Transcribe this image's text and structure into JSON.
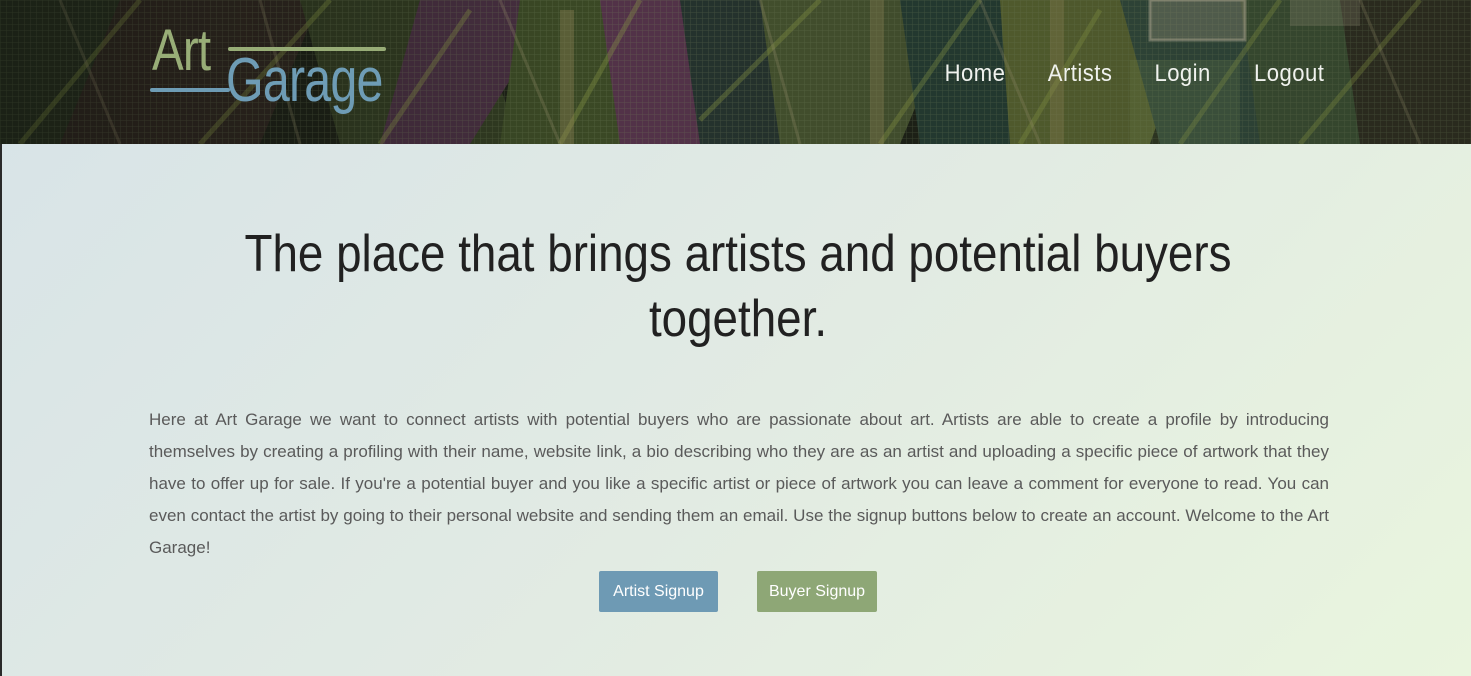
{
  "header": {
    "logo": {
      "word1": "Art",
      "word2": "Garage"
    },
    "nav": [
      {
        "label": "Home"
      },
      {
        "label": "Artists"
      },
      {
        "label": "Login"
      },
      {
        "label": "Logout"
      }
    ]
  },
  "main": {
    "headline": "The place that brings artists and potential buyers together.",
    "intro": "Here at Art Garage we want to connect artists with potential buyers who are passionate about art. Artists are able to create a profile by introducing themselves by creating a profiling with their name, website link, a bio describing who they are as an artist and uploading a specific piece of artwork that they have to offer up for sale. If you're a potential buyer and you like a specific artist or piece of artwork you can leave a comment for everyone to read. You can even contact the artist by going to their personal website and sending them an email. Use the signup buttons below to create an account. Welcome to the Art Garage!",
    "buttons": {
      "artist_signup": "Artist Signup",
      "buyer_signup": "Buyer Signup"
    }
  },
  "colors": {
    "logo_green": "#98ad77",
    "logo_blue": "#6e9cb5",
    "artist_button": "#6e9ab4",
    "buyer_button": "#8ea776",
    "headline_text": "#212121",
    "body_text": "#5a5a5a"
  }
}
